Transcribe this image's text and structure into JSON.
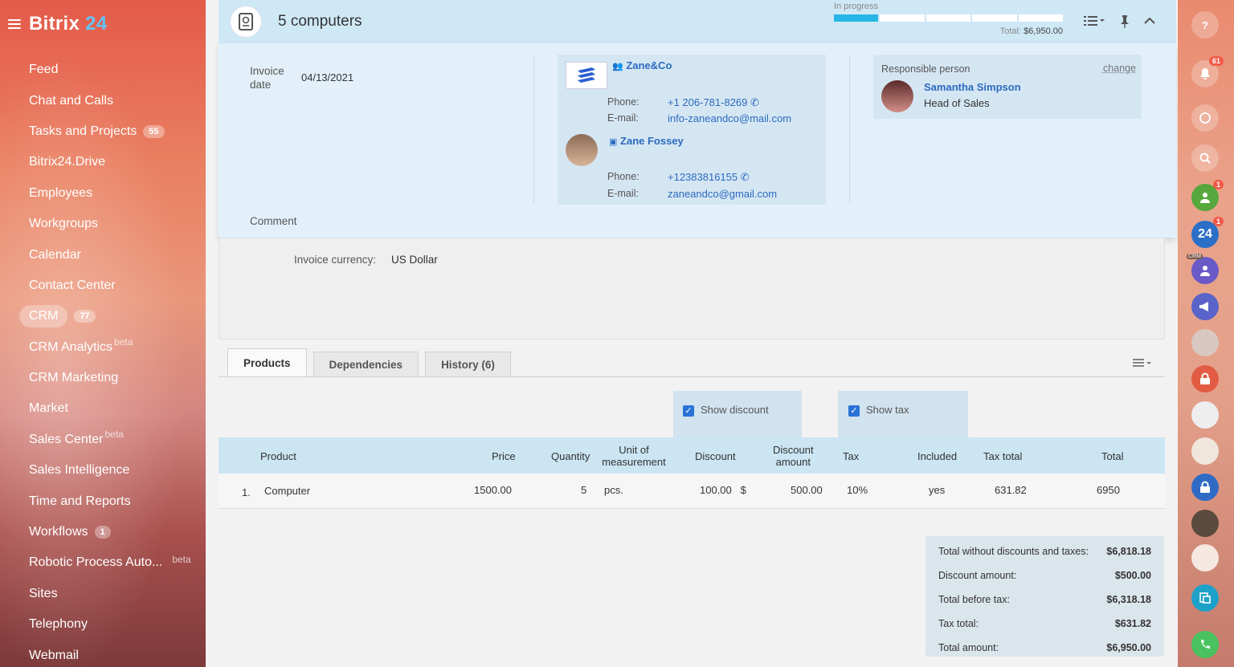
{
  "app": {
    "name_part1": "Bitrix",
    "name_part2": "24"
  },
  "sidebar": {
    "items": [
      {
        "label": "Feed"
      },
      {
        "label": "Chat and Calls"
      },
      {
        "label": "Tasks and Projects",
        "badge": "55"
      },
      {
        "label": "Bitrix24.Drive"
      },
      {
        "label": "Employees"
      },
      {
        "label": "Workgroups"
      },
      {
        "label": "Calendar"
      },
      {
        "label": "Contact Center"
      },
      {
        "label": "CRM",
        "badge": "77"
      },
      {
        "label": "CRM Analytics",
        "beta": "beta"
      },
      {
        "label": "CRM Marketing"
      },
      {
        "label": "Market"
      },
      {
        "label": "Sales Center",
        "beta": "beta"
      },
      {
        "label": "Sales Intelligence"
      },
      {
        "label": "Time and Reports"
      },
      {
        "label": "Workflows",
        "badge": "1"
      },
      {
        "label": "Robotic Process Auto...",
        "beta": "beta"
      },
      {
        "label": "Sites"
      },
      {
        "label": "Telephony"
      },
      {
        "label": "Webmail"
      }
    ]
  },
  "rightbar": {
    "notif_count": "61",
    "badge1": "1",
    "badge2": "1",
    "b24": "24",
    "crm_tag": "CRM"
  },
  "header": {
    "title": "5 computers",
    "status": "In progress",
    "total_label": "Total:",
    "total_value": "$6,950.00",
    "progress_fraction": 0.2
  },
  "invoice": {
    "date_label": "Invoice date",
    "date_value": "04/13/2021",
    "comment_label": "Comment",
    "company": {
      "name": "Zane&Co",
      "phone_label": "Phone:",
      "phone": "+1 206-781-8269",
      "email_label": "E-mail:",
      "email": "info-zaneandco@mail.com"
    },
    "contact": {
      "name": "Zane Fossey",
      "phone_label": "Phone:",
      "phone": "+12383816155",
      "email_label": "E-mail:",
      "email": "zaneandco@gmail.com"
    },
    "responsible": {
      "label": "Responsible person",
      "change": "change",
      "name": "Samantha Simpson",
      "position": "Head of Sales"
    },
    "currency_label": "Invoice currency:",
    "currency_value": "US Dollar"
  },
  "tabs": [
    {
      "label": "Products"
    },
    {
      "label": "Dependencies"
    },
    {
      "label": "History (6)"
    }
  ],
  "options": {
    "show_discount": "Show discount",
    "show_tax": "Show tax"
  },
  "table": {
    "headers": {
      "product": "Product",
      "price": "Price",
      "quantity": "Quantity",
      "unit1": "Unit of",
      "unit2": "measurement",
      "discount": "Discount",
      "discount_amount1": "Discount",
      "discount_amount2": "amount",
      "tax": "Tax",
      "included": "Included",
      "tax_total": "Tax total",
      "total": "Total"
    },
    "row": {
      "num": "1.",
      "product": "Computer",
      "price": "1500.00",
      "quantity": "5",
      "unit": "pcs.",
      "discount": "100.00",
      "discount_currency": "$",
      "discount_amount": "500.00",
      "tax": "10%",
      "included": "yes",
      "tax_total": "631.82",
      "total": "6950"
    }
  },
  "totals": [
    {
      "label": "Total without discounts and taxes:",
      "value": "$6,818.18"
    },
    {
      "label": "Discount amount:",
      "value": "$500.00"
    },
    {
      "label": "Total before tax:",
      "value": "$6,318.18"
    },
    {
      "label": "Tax total:",
      "value": "$631.82"
    },
    {
      "label": "Total amount:",
      "value": "$6,950.00"
    }
  ]
}
